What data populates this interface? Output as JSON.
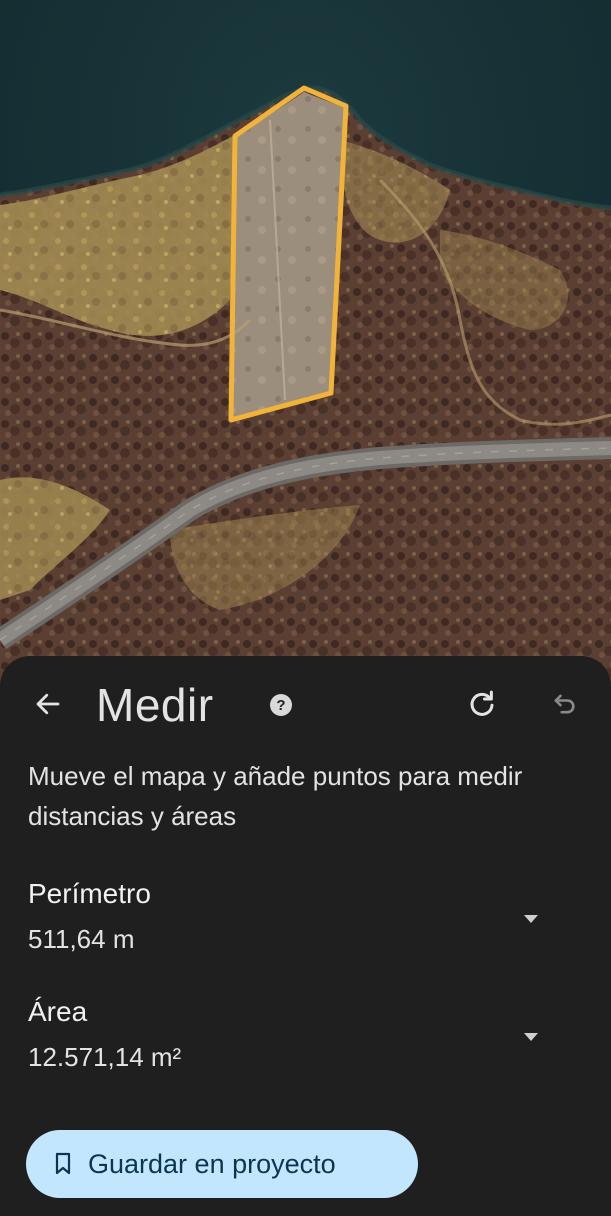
{
  "map": {
    "overlay_color": "#f2b33a",
    "description_icon": "satellite-map"
  },
  "header": {
    "title": "Medir",
    "back_icon": "arrow-left-icon",
    "help_icon": "help-circle-icon",
    "redo_icon": "redo-icon",
    "undo_icon": "undo-icon"
  },
  "instructions": "Mueve el mapa y añade puntos para medir distancias y áreas",
  "metrics": {
    "perimeter": {
      "label": "Perímetro",
      "value": "511,64 m"
    },
    "area": {
      "label": "Área",
      "value": "12.571,14 m²"
    }
  },
  "save_button": {
    "label": "Guardar en proyecto",
    "icon": "bookmark-icon",
    "bg_color": "#c3e6ff"
  },
  "colors": {
    "sheet_bg": "#1f1f1f",
    "text": "#e3e3e3"
  }
}
